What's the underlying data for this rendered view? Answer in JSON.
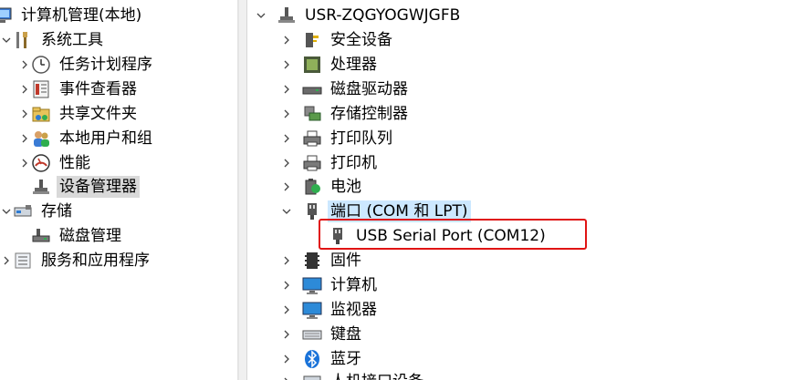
{
  "left_tree": {
    "root": "计算机管理(本地)",
    "system_tools": "系统工具",
    "task_scheduler": "任务计划程序",
    "event_viewer": "事件查看器",
    "shared_folders": "共享文件夹",
    "local_users_groups": "本地用户和组",
    "performance": "性能",
    "device_manager": "设备管理器",
    "storage": "存储",
    "disk_management": "磁盘管理",
    "services_apps": "服务和应用程序"
  },
  "right_tree": {
    "computer_name": "USR-ZQGYOGWJGFB",
    "categories": [
      "安全设备",
      "处理器",
      "磁盘驱动器",
      "存储控制器",
      "打印队列",
      "打印机",
      "电池",
      "端口 (COM 和 LPT)",
      "固件",
      "计算机",
      "监视器",
      "键盘",
      "蓝牙",
      "人机接口设备"
    ],
    "port_child": "USB Serial Port (COM12)"
  },
  "colors": {
    "selection": "#cce8ff",
    "highlight_box": "#e01414"
  }
}
